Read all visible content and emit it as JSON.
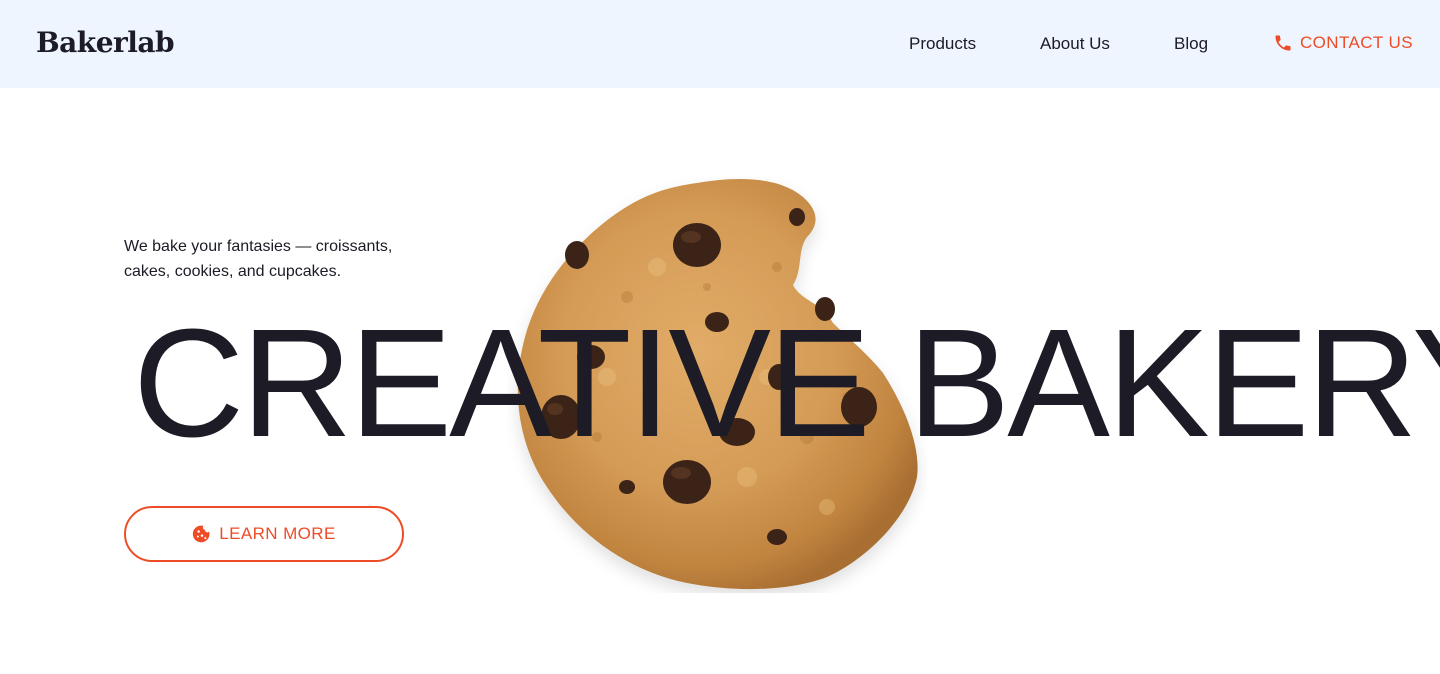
{
  "brand": {
    "name": "Bakerlab"
  },
  "nav": {
    "items": [
      {
        "label": "Products"
      },
      {
        "label": "About Us"
      },
      {
        "label": "Blog"
      }
    ],
    "contact": {
      "label": "CONTACT US",
      "icon": "phone-icon"
    }
  },
  "hero": {
    "tagline": "We bake your fantasies — croissants, cakes, cookies, and cupcakes.",
    "title": "CREATIVE BAKERY",
    "cta": {
      "label": "LEARN MORE",
      "icon": "cookie-icon"
    },
    "image": "chocolate-chip-cookie"
  },
  "colors": {
    "accent": "#ee4c27",
    "text": "#1c1b26",
    "header_bg": "#eef5ff"
  }
}
